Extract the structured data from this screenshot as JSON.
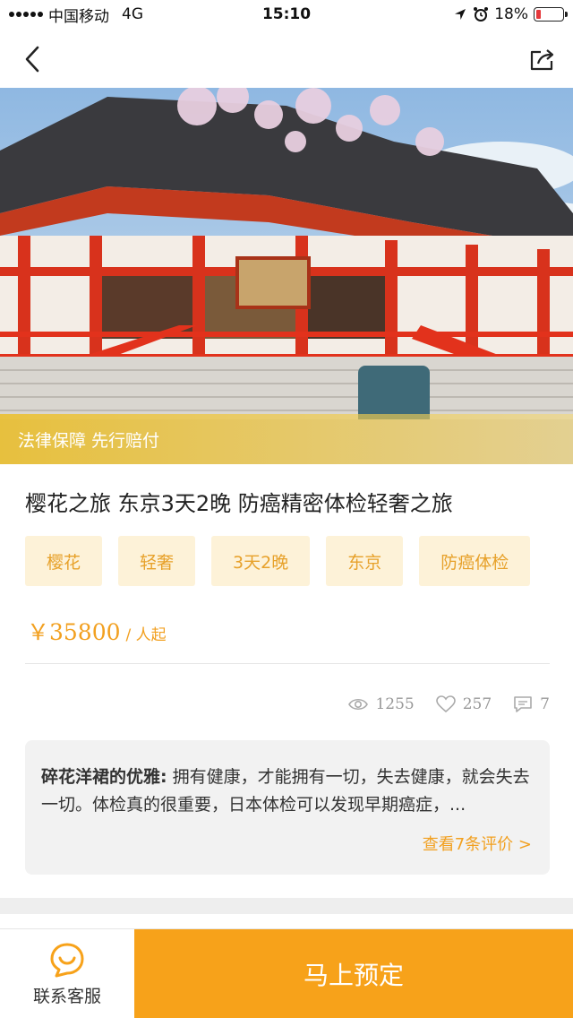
{
  "status_bar": {
    "carrier": "中国移动",
    "network": "4G",
    "time": "15:10",
    "battery": "18%",
    "battery_level": 0.18,
    "icons": [
      "signal-icon",
      "location-icon",
      "alarm-icon",
      "battery-icon"
    ]
  },
  "nav": {
    "back_icon": "chevron-left-icon",
    "share_icon": "share-icon"
  },
  "hero": {
    "banner_text": "法律保障 先行赔付"
  },
  "product": {
    "title": "樱花之旅 东京3天2晚 防癌精密体检轻奢之旅",
    "tags": [
      "樱花",
      "轻奢",
      "3天2晚",
      "东京",
      "防癌体检"
    ],
    "price": "￥35800",
    "price_unit": "/ 人起"
  },
  "stats": {
    "views": "1255",
    "likes": "257",
    "comments": "7"
  },
  "review": {
    "author": "碎花洋裙的优雅:",
    "text": " 拥有健康，才能拥有一切，失去健康，就会失去一切。体检真的很重要，日本体检可以发现早期癌症，...",
    "more_link": "查看7条评价 >"
  },
  "bottom_bar": {
    "service_label": "联系客服",
    "book_label": "马上预定"
  },
  "colors": {
    "accent": "#f7a21a",
    "tag_bg": "#fdf2d8",
    "tag_text": "#e7a12a",
    "banner": "#ecbf28"
  }
}
